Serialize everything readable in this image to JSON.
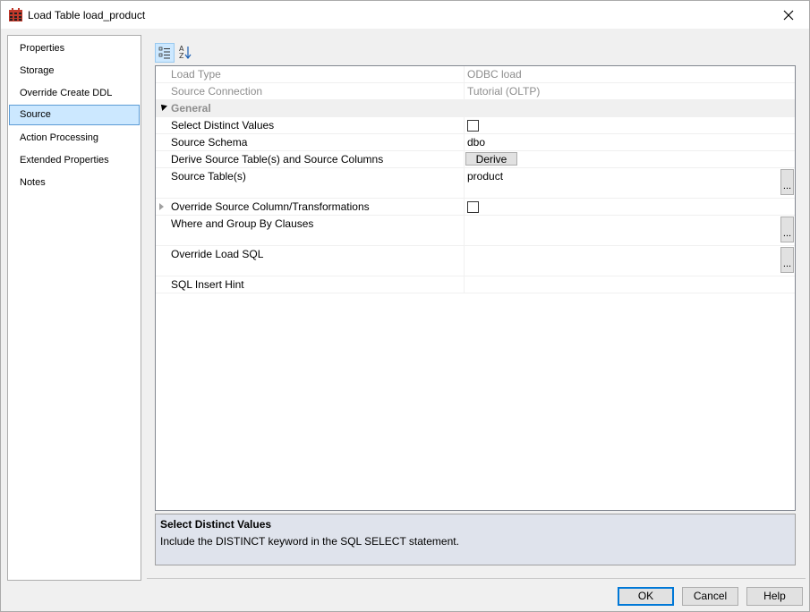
{
  "window": {
    "title": "Load Table load_product"
  },
  "nav": {
    "items": [
      {
        "label": "Properties"
      },
      {
        "label": "Storage"
      },
      {
        "label": "Override Create DDL"
      },
      {
        "label": "Source",
        "selected": true
      },
      {
        "label": "Action Processing"
      },
      {
        "label": "Extended Properties"
      },
      {
        "label": "Notes"
      }
    ]
  },
  "toolbar": {
    "categorized_icon": "categorized-view-icon",
    "alphabetical_icon": "sort-alphabetical-icon"
  },
  "grid": {
    "load_type": {
      "name": "Load Type",
      "value": "ODBC load"
    },
    "source_connection": {
      "name": "Source Connection",
      "value": "Tutorial (OLTP)"
    },
    "category": "General",
    "select_distinct": {
      "name": "Select Distinct Values",
      "checked": false
    },
    "source_schema": {
      "name": "Source Schema",
      "value": "dbo"
    },
    "derive": {
      "name": "Derive Source Table(s) and Source Columns",
      "button": "Derive"
    },
    "source_tables": {
      "name": "Source Table(s)",
      "value": "product"
    },
    "override_source": {
      "name": "Override Source Column/Transformations",
      "checked": false
    },
    "where_group": {
      "name": "Where and Group By Clauses",
      "value": ""
    },
    "override_sql": {
      "name": "Override Load SQL",
      "value": ""
    },
    "sql_hint": {
      "name": "SQL Insert Hint",
      "value": ""
    },
    "ellipsis": "..."
  },
  "description": {
    "title": "Select Distinct Values",
    "text": "Include the DISTINCT keyword in the SQL SELECT statement."
  },
  "buttons": {
    "ok": "OK",
    "cancel": "Cancel",
    "help": "Help"
  },
  "colors": {
    "selection": "#cce8ff",
    "selection_border": "#5b9bd5",
    "description_bg": "#dfe3ec",
    "readonly_text": "#8d8d8d"
  }
}
